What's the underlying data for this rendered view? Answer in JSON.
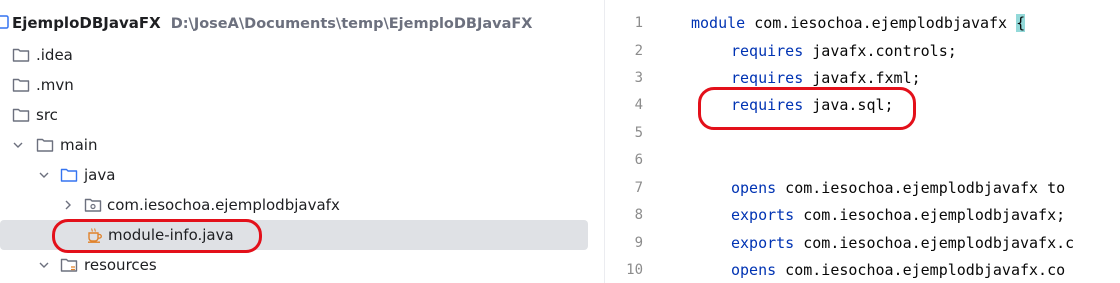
{
  "project_tree": {
    "root": {
      "name": "EjemploDBJavaFX",
      "path": "D:\\JoseA\\Documents\\temp\\EjemploDBJavaFX"
    },
    "items": [
      {
        "label": ".idea"
      },
      {
        "label": ".mvn"
      },
      {
        "label": "src"
      },
      {
        "label": "main"
      },
      {
        "label": "java"
      },
      {
        "label": "com.iesochoa.ejemplodbjavafx"
      },
      {
        "label": "module-info.java"
      },
      {
        "label": "resources"
      }
    ]
  },
  "editor": {
    "line_numbers": [
      "1",
      "2",
      "3",
      "4",
      "5",
      "6",
      "7",
      "8",
      "9",
      "10"
    ],
    "lines": [
      {
        "kw": "module",
        "rest": " com.iesochoa.ejemplodbjavafx ",
        "brace": "{"
      },
      {
        "kw": "requires",
        "rest": " javafx.controls;"
      },
      {
        "kw": "requires",
        "rest": " javafx.fxml;"
      },
      {
        "kw": "requires",
        "rest": " java.sql;"
      },
      {
        "kw": "",
        "rest": ""
      },
      {
        "kw": "",
        "rest": ""
      },
      {
        "kw": "opens",
        "rest": " com.iesochoa.ejemplodbjavafx to"
      },
      {
        "kw": "exports",
        "rest": " com.iesochoa.ejemplodbjavafx;"
      },
      {
        "kw": "exports",
        "rest": " com.iesochoa.ejemplodbjavafx.c"
      },
      {
        "kw": "opens",
        "rest": " com.iesochoa.ejemplodbjavafx.co"
      }
    ]
  },
  "colors": {
    "keyword": "#0033b3",
    "annotation": "#e3101a",
    "selection": "#dfe1e5",
    "brace_match": "#93d9d9"
  }
}
